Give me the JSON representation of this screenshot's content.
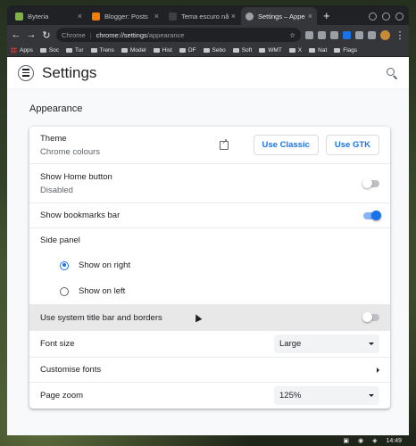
{
  "tabs": [
    {
      "title": "Byteria",
      "fav_color": "#7cb342"
    },
    {
      "title": "Blogger: Posts",
      "fav_color": "#f57c00"
    },
    {
      "title": "Tema escuro não c",
      "fav_color": "#3c4043"
    },
    {
      "title": "Settings – Appearanc",
      "fav_color": "#9aa0a6",
      "active": true
    }
  ],
  "toolbar": {
    "url_prefix": "Chrome",
    "url_host": "chrome://settings",
    "url_path": "/appearance"
  },
  "bookmarks": [
    "Apps",
    "Soc",
    "Tur",
    "Trens",
    "Model",
    "Hist",
    "DF",
    "Sebo",
    "Soft",
    "WMT",
    "X",
    "Nat",
    "Flags"
  ],
  "header": {
    "title": "Settings"
  },
  "section": {
    "title": "Appearance"
  },
  "theme": {
    "label": "Theme",
    "value": "Chrome colours",
    "btn_classic": "Use Classic",
    "btn_gtk": "Use GTK"
  },
  "home_button": {
    "label": "Show Home button",
    "value": "Disabled",
    "enabled": false
  },
  "bookmarks_bar": {
    "label": "Show bookmarks bar",
    "enabled": true
  },
  "side_panel": {
    "label": "Side panel",
    "options": [
      "Show on right",
      "Show on left"
    ],
    "selected": 0
  },
  "system_title_bar": {
    "label": "Use system title bar and borders",
    "enabled": false
  },
  "font_size": {
    "label": "Font size",
    "value": "Large"
  },
  "customise_fonts": {
    "label": "Customise fonts"
  },
  "page_zoom": {
    "label": "Page zoom",
    "value": "125%"
  },
  "colors": {
    "accent": "#1a73e8",
    "hover_row": "#e8e8e8"
  },
  "taskbar": {
    "clock": "14:49"
  }
}
